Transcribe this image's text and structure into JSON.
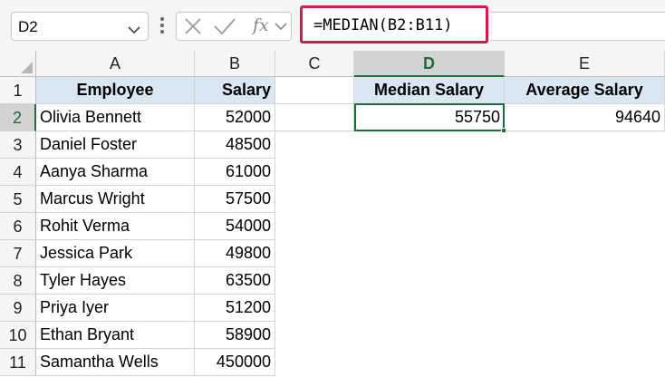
{
  "name_box": {
    "value": "D2",
    "icon": "chevron-down-icon"
  },
  "formula_bar": {
    "buttons": [
      "cancel-x-icon",
      "enter-check-icon",
      "insert-function-icon"
    ],
    "fx_label": "fx",
    "formula": "=MEDIAN(B2:B11)"
  },
  "columns": [
    "A",
    "B",
    "C",
    "D",
    "E"
  ],
  "selected_column": "D",
  "rows": [
    "1",
    "2",
    "3",
    "4",
    "5",
    "6",
    "7",
    "8",
    "9",
    "10",
    "11"
  ],
  "selected_row": "2",
  "sheet": {
    "a1": "Employee",
    "b1": "Salary",
    "d1": "Median Salary",
    "e1": "Average Salary",
    "d2": "55750",
    "e2": "94640",
    "employees": [
      {
        "name": "Olivia Bennett",
        "salary": "52000"
      },
      {
        "name": "Daniel Foster",
        "salary": "48500"
      },
      {
        "name": "Aanya Sharma",
        "salary": "61000"
      },
      {
        "name": "Marcus Wright",
        "salary": "57500"
      },
      {
        "name": "Rohit Verma",
        "salary": "54000"
      },
      {
        "name": "Jessica Park",
        "salary": "49800"
      },
      {
        "name": "Tyler Hayes",
        "salary": "63500"
      },
      {
        "name": "Priya Iyer",
        "salary": "51200"
      },
      {
        "name": "Ethan Bryant",
        "salary": "58900"
      },
      {
        "name": "Samantha Wells",
        "salary": "450000"
      }
    ]
  },
  "colors": {
    "header_fill": "#dae6f1",
    "selection_green": "#1e6b3c",
    "formula_highlight": "#d11a4f"
  }
}
